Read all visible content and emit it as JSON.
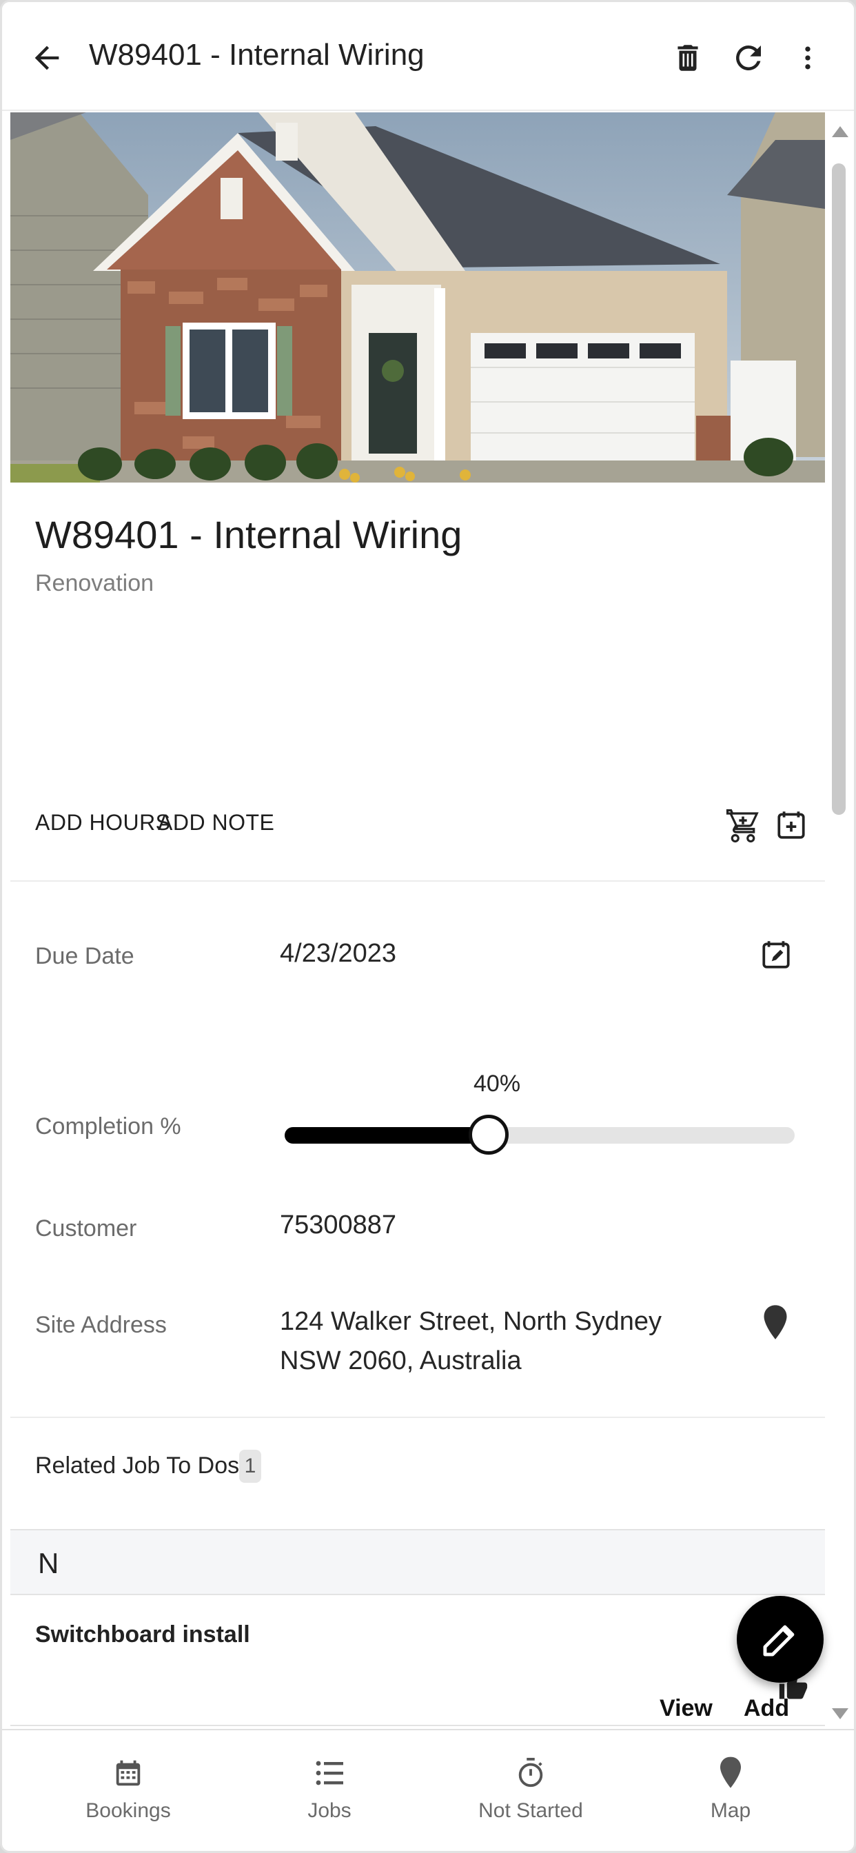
{
  "header": {
    "title": "W89401 - Internal Wiring",
    "icons": [
      "back-arrow-icon",
      "trash-icon",
      "refresh-icon",
      "more-vert-icon"
    ]
  },
  "job": {
    "title": "W89401 - Internal Wiring",
    "type": "Renovation",
    "actions": {
      "add_hours": "ADD HOURS",
      "add_note": "ADD NOTE"
    }
  },
  "fields": {
    "due_date_label": "Due Date",
    "due_date_value": "4/23/2023",
    "completion_label": "Completion %",
    "completion_value": "40%",
    "completion_fraction": 0.4,
    "customer_label": "Customer",
    "customer_value": "75300887",
    "site_address_label": "Site Address",
    "site_address_value": "124 Walker Street, North Sydney NSW 2060, Australia"
  },
  "related": {
    "label": "Related Job To Dos",
    "count": "1",
    "group_letter": "N",
    "items": [
      {
        "title": "Switchboard install",
        "status": "N"
      }
    ],
    "view_label": "View",
    "add_label_partial": "Add"
  },
  "bottom_nav": [
    {
      "label": "Bookings",
      "icon": "calendar-icon"
    },
    {
      "label": "Jobs",
      "icon": "list-icon"
    },
    {
      "label": "Not Started",
      "icon": "stopwatch-icon"
    },
    {
      "label": "Map",
      "icon": "map-pin-icon"
    }
  ],
  "colors": {
    "accent": "#000000",
    "muted_text": "#6b6b6b",
    "divider": "#ececec",
    "group_header_bg": "#f5f6f8"
  }
}
